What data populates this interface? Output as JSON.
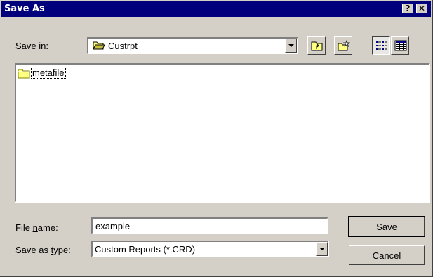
{
  "window": {
    "title": "Save As",
    "help_glyph": "?",
    "close_glyph": "✕"
  },
  "save_in": {
    "label_before": "Save ",
    "label_mnemonic": "i",
    "label_after": "n:",
    "value": "Custrpt",
    "icon": "folder-open-icon"
  },
  "toolbar": {
    "up_one_level_icon": "up-folder-icon",
    "new_folder_icon": "new-folder-icon",
    "list_view_icon": "list-view-icon",
    "details_view_icon": "details-view-icon",
    "active_view": "list"
  },
  "files": [
    {
      "name": "metafile",
      "icon": "folder-icon",
      "focused": true
    }
  ],
  "file_name": {
    "label_before": "File ",
    "label_mnemonic": "n",
    "label_after": "ame:",
    "value": "example"
  },
  "save_as_type": {
    "label_before": "Save as ",
    "label_mnemonic": "t",
    "label_after": "ype:",
    "value": "Custom Reports (*.CRD)"
  },
  "buttons": {
    "save_mnemonic": "S",
    "save_rest": "ave",
    "cancel": "Cancel"
  },
  "colors": {
    "titlebar": "#00007c",
    "face": "#d4d0c8",
    "folder": "#ffff80"
  }
}
